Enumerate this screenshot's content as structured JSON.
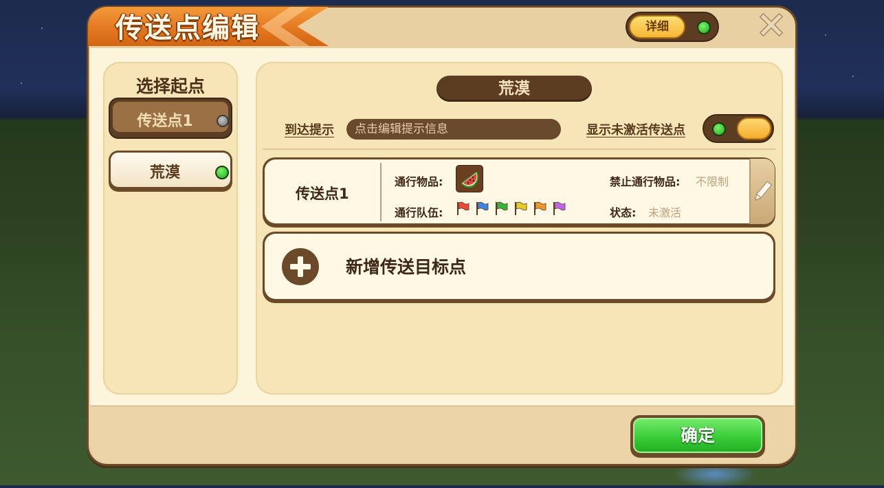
{
  "header": {
    "title": "传送点编辑",
    "detail_label": "详细",
    "close_icon": "close-icon"
  },
  "left_panel": {
    "title": "选择起点",
    "items": [
      {
        "label": "传送点1",
        "selected": true,
        "status": "inactive",
        "status_color": "#808080"
      },
      {
        "label": "荒漠",
        "selected": false,
        "status": "active",
        "status_color": "#2fbf2a"
      }
    ]
  },
  "right_panel": {
    "world_name": "荒漠",
    "arrive_hint_label": "到达提示",
    "arrive_hint_placeholder": "点击编辑提示信息",
    "show_inactive_label": "显示未激活传送点",
    "teleport_points": [
      {
        "name": "传送点1",
        "pass_item_label": "通行物品:",
        "pass_item_icon": "watermelon-icon",
        "pass_team_label": "通行队伍:",
        "team_flags": [
          "#e84a3a",
          "#3d86e0",
          "#34b53a",
          "#e6cc2a",
          "#f0952a",
          "#c165e8"
        ],
        "forbidden_label": "禁止通行物品:",
        "forbidden_value": "不限制",
        "status_label": "状态:",
        "status_value": "未激活"
      }
    ],
    "add_label": "新增传送目标点"
  },
  "footer": {
    "confirm_label": "确定"
  },
  "colors": {
    "frame": "#e9d0a3",
    "brown": "#5d3d22",
    "orange": "#e37822",
    "green": "#3bcc3a"
  }
}
